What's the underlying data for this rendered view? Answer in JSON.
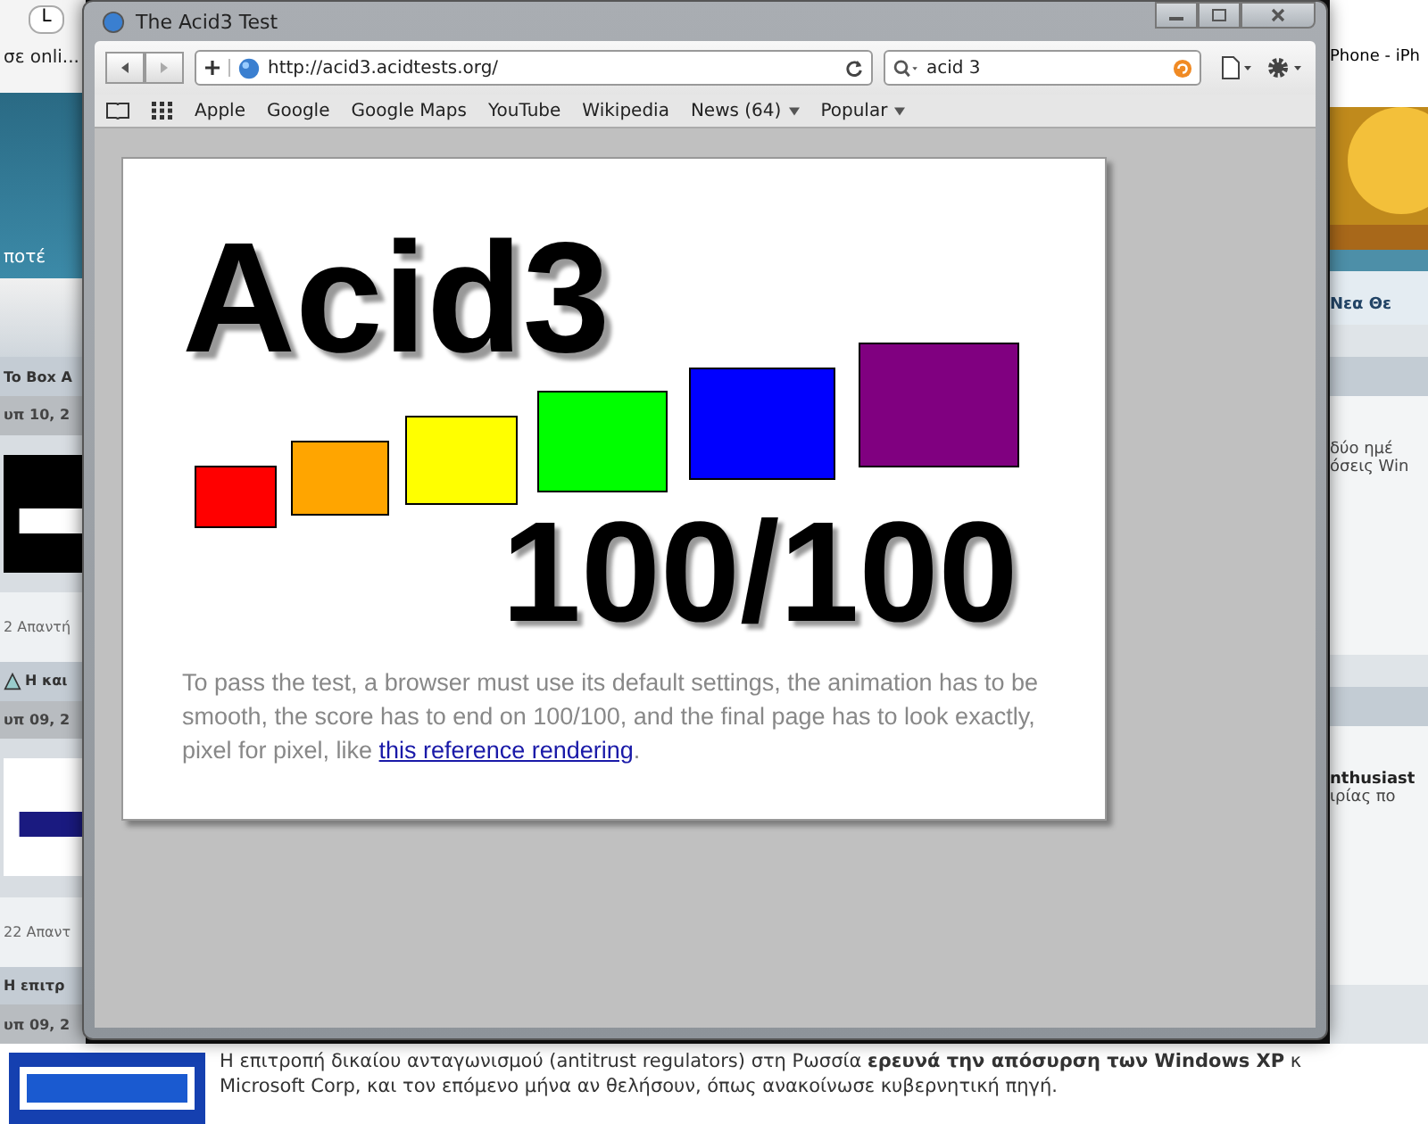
{
  "window": {
    "title": "The Acid3 Test"
  },
  "toolbar": {
    "address": "http://acid3.acidtests.org/",
    "search": "acid 3"
  },
  "bookmarks": [
    {
      "label": "Apple",
      "menu": false
    },
    {
      "label": "Google",
      "menu": false
    },
    {
      "label": "Google Maps",
      "menu": false
    },
    {
      "label": "YouTube",
      "menu": false
    },
    {
      "label": "Wikipedia",
      "menu": false
    },
    {
      "label": "News (64)",
      "menu": true
    },
    {
      "label": "Popular",
      "menu": true
    }
  ],
  "page": {
    "heading": "Acid3",
    "score": "100/100",
    "boxes": [
      {
        "color": "#ff0000"
      },
      {
        "color": "#ffa500"
      },
      {
        "color": "#ffff00"
      },
      {
        "color": "#00ff00"
      },
      {
        "color": "#0000ff"
      },
      {
        "color": "#800080"
      }
    ],
    "text": "To pass the test, a browser must use its default settings, the animation has to be smooth, the score has to end on 100/100, and the final page has to look exactly, pixel for pixel, like ",
    "link": "this reference rendering",
    "text_end": "."
  },
  "background": {
    "tab": "L",
    "top_left": "σε onli...",
    "banner_left": "ποτέ",
    "left": [
      {
        "kind": "header",
        "text": "To Box A",
        "warning": false
      },
      {
        "kind": "date",
        "text": "υπ 10, 2"
      },
      {
        "kind": "logo"
      },
      {
        "kind": "replies",
        "text": "2 Απαντή"
      },
      {
        "kind": "header",
        "text": "Η και",
        "warning": true
      },
      {
        "kind": "date",
        "text": "υπ 09, 2"
      },
      {
        "kind": "logo"
      },
      {
        "kind": "replies",
        "text": "22 Απαντ"
      },
      {
        "kind": "header",
        "text": "Η επιτρ",
        "warning": false
      },
      {
        "kind": "date",
        "text": "υπ 09, 2"
      }
    ],
    "top_right": "Phone - iPh",
    "nav_right": "Νεα Θε",
    "right_lines": [
      [
        "δύο ημέ",
        "όσεις Win"
      ],
      [
        "nthusiast",
        "ιρίας πο"
      ]
    ],
    "bottom_lines": [
      "Η επιτροπή δικαίου ανταγωνισμού (antitrust regulators) στη Ρωσσία **ερευνά την απόσυρση των Windows XP** κ",
      "Microsoft Corp, και τον επόμενο μήνα αν θελήσουν, όπως ανακοίνωσε κυβερνητική πηγή."
    ]
  }
}
